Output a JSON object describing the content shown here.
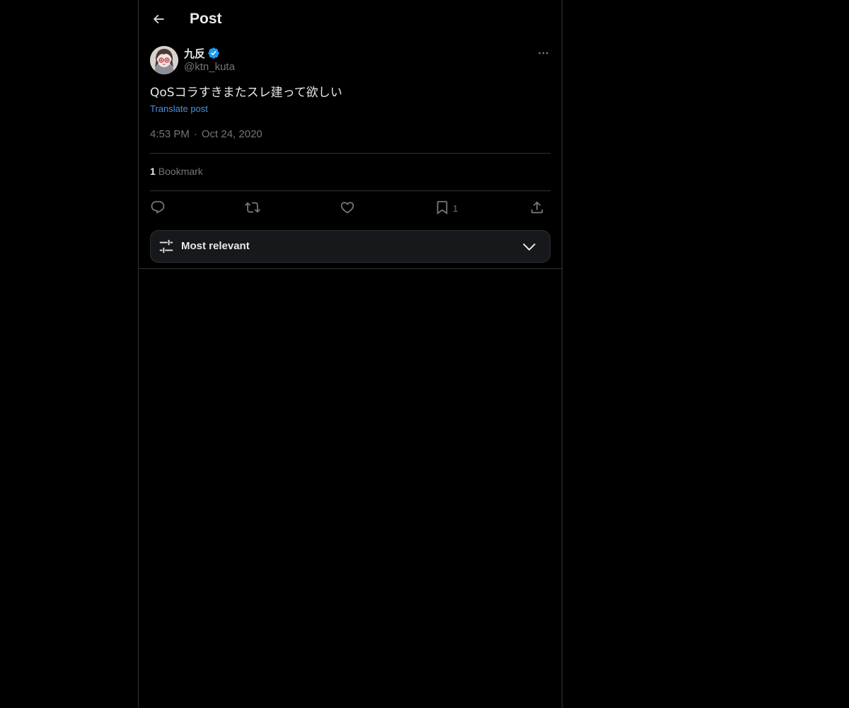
{
  "header": {
    "title": "Post",
    "back_icon": "arrow-left-icon"
  },
  "author": {
    "display_name": "九反",
    "handle": "@ktn_kuta",
    "verified": true,
    "verified_color": "#1d9bf0"
  },
  "post": {
    "text": "QoSコラすきまたスレ建って欲しい",
    "translate_label": "Translate post",
    "time": "4:53 PM",
    "separator": "·",
    "date": "Oct 24, 2020"
  },
  "stats": {
    "bookmark_count": "1",
    "bookmark_label": "Bookmark"
  },
  "actions": {
    "reply_icon": "reply-icon",
    "repost_icon": "repost-icon",
    "like_icon": "heart-icon",
    "bookmark_icon": "bookmark-icon",
    "bookmark_count": "1",
    "share_icon": "share-icon"
  },
  "sort": {
    "label": "Most relevant",
    "icon": "sliders-icon",
    "chevron": "chevron-down-icon"
  },
  "colors": {
    "background": "#000000",
    "text_primary": "#e7e9ea",
    "text_secondary": "#71767b",
    "link": "#4b93dd",
    "border": "#2f3336"
  }
}
